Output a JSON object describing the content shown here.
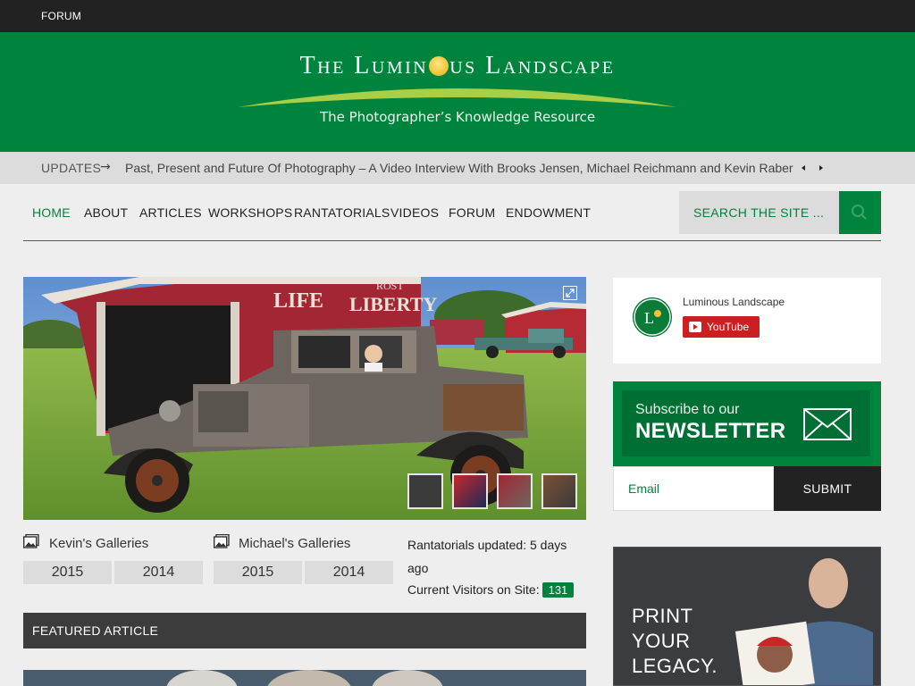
{
  "topbar": {
    "forum_label": "FORUM"
  },
  "header": {
    "title_before": "The Lumin",
    "title_after": "us Landscape",
    "tagline": "The Photographer’s Knowledge Resource"
  },
  "ticker": {
    "label": "UPDATES",
    "arrow": "→",
    "headline": "Past, Present and Future Of Photography – A Video Interview With Brooks Jensen, Michael Reichmann and Kevin Raber"
  },
  "nav": {
    "items": [
      "HOME",
      "ABOUT",
      "ARTICLES",
      "WORKSHOPS",
      "RANTATORIALS",
      "VIDEOS",
      "FORUM",
      "ENDOWMENT"
    ],
    "search_placeholder": "SEARCH THE SITE ..."
  },
  "galleries": {
    "kevin": {
      "label": "Kevin's Galleries",
      "years": [
        "2015",
        "2014"
      ]
    },
    "michael": {
      "label": "Michael's Galleries",
      "years": [
        "2015",
        "2014"
      ]
    }
  },
  "status": {
    "rantatorials_line1": "Rantatorials updated: 5 days",
    "rantatorials_line2": "ago",
    "visitors_label": "Current Visitors on Site:",
    "visitors_count": "131"
  },
  "featured": {
    "heading": "FEATURED ARTICLE"
  },
  "hero": {
    "sign_left": "LIFE",
    "sign_right": "LIBERTY",
    "sign_top": "ROST"
  },
  "sidebar": {
    "youtube": {
      "channel_name": "Luminous Landscape",
      "button_label": "YouTube"
    },
    "newsletter": {
      "subscribe_text": "Subscribe to our",
      "newsletter_text": "NEWSLETTER",
      "email_placeholder": "Email",
      "submit_label": "SUBMIT"
    },
    "ad": {
      "lines": [
        "PRINT",
        "YOUR",
        "LEGACY."
      ]
    }
  },
  "colors": {
    "brand_green": "#00843d",
    "dark_bar": "#222222",
    "youtube_red": "#cc1f1f"
  }
}
